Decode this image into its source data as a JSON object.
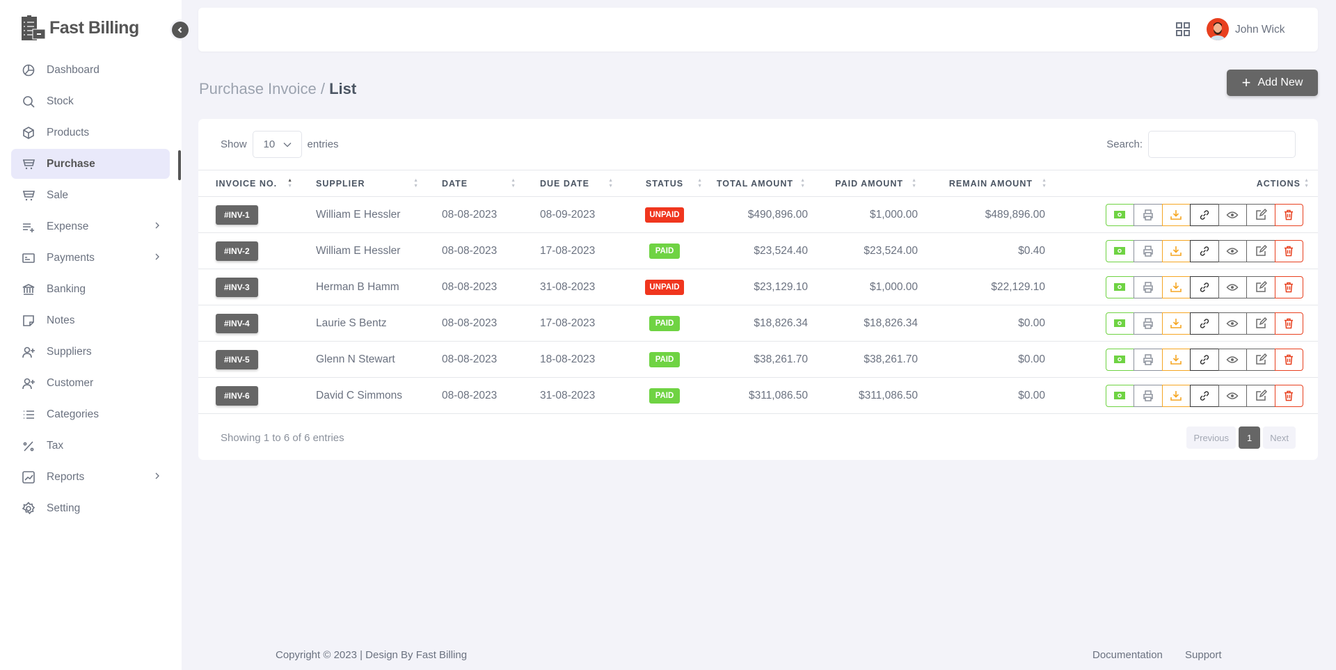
{
  "app": {
    "name": "Fast Billing"
  },
  "sidebar": {
    "items": [
      {
        "label": "Dashboard",
        "icon": "pie-chart-icon"
      },
      {
        "label": "Stock",
        "icon": "search-icon"
      },
      {
        "label": "Products",
        "icon": "box-icon"
      },
      {
        "label": "Purchase",
        "icon": "cart-icon",
        "active": true
      },
      {
        "label": "Sale",
        "icon": "cart-icon"
      },
      {
        "label": "Expense",
        "icon": "list-plus-icon",
        "submenu": true
      },
      {
        "label": "Payments",
        "icon": "card-icon",
        "submenu": true
      },
      {
        "label": "Banking",
        "icon": "bank-icon"
      },
      {
        "label": "Notes",
        "icon": "note-icon"
      },
      {
        "label": "Suppliers",
        "icon": "user-plus-icon"
      },
      {
        "label": "Customer",
        "icon": "user-plus-icon"
      },
      {
        "label": "Categories",
        "icon": "list-icon"
      },
      {
        "label": "Tax",
        "icon": "percent-icon"
      },
      {
        "label": "Reports",
        "icon": "chart-icon",
        "submenu": true
      },
      {
        "label": "Setting",
        "icon": "gear-icon"
      }
    ]
  },
  "header": {
    "user_name": "John Wick"
  },
  "page": {
    "breadcrumb_parent": "Purchase Invoice / ",
    "breadcrumb_current": "List",
    "add_new": "Add New"
  },
  "table_controls": {
    "show": "Show",
    "entries_value": "10",
    "entries": "entries",
    "search_label": "Search:"
  },
  "table": {
    "columns": [
      "INVOICE NO.",
      "SUPPLIER",
      "DATE",
      "DUE DATE",
      "STATUS",
      "TOTAL AMOUNT",
      "PAID AMOUNT",
      "REMAIN AMOUNT",
      "ACTIONS"
    ],
    "rows": [
      {
        "inv": "#INV-1",
        "supplier": "William E Hessler",
        "date": "08-08-2023",
        "due": "08-09-2023",
        "status": "UNPAID",
        "total": "$490,896.00",
        "paid": "$1,000.00",
        "remain": "$489,896.00"
      },
      {
        "inv": "#INV-2",
        "supplier": "William E Hessler",
        "date": "08-08-2023",
        "due": "17-08-2023",
        "status": "PAID",
        "total": "$23,524.40",
        "paid": "$23,524.00",
        "remain": "$0.40"
      },
      {
        "inv": "#INV-3",
        "supplier": "Herman B Hamm",
        "date": "08-08-2023",
        "due": "31-08-2023",
        "status": "UNPAID",
        "total": "$23,129.10",
        "paid": "$1,000.00",
        "remain": "$22,129.10"
      },
      {
        "inv": "#INV-4",
        "supplier": "Laurie S Bentz",
        "date": "08-08-2023",
        "due": "17-08-2023",
        "status": "PAID",
        "total": "$18,826.34",
        "paid": "$18,826.34",
        "remain": "$0.00"
      },
      {
        "inv": "#INV-5",
        "supplier": "Glenn N Stewart",
        "date": "08-08-2023",
        "due": "18-08-2023",
        "status": "PAID",
        "total": "$38,261.70",
        "paid": "$38,261.70",
        "remain": "$0.00"
      },
      {
        "inv": "#INV-6",
        "supplier": "David C Simmons",
        "date": "08-08-2023",
        "due": "31-08-2023",
        "status": "PAID",
        "total": "$311,086.50",
        "paid": "$311,086.50",
        "remain": "$0.00"
      }
    ]
  },
  "pagination": {
    "info": "Showing 1 to 6 of 6 entries",
    "previous": "Previous",
    "current": "1",
    "next": "Next"
  },
  "footer": {
    "copyright": "Copyright © 2023 | Design By Fast Billing",
    "documentation": "Documentation",
    "support": "Support"
  },
  "colors": {
    "payment": "#6fd343",
    "print": "#8b919c",
    "download": "#f5a623",
    "link": "#333333",
    "view": "#6b6b6b",
    "edit": "#6b6b6b",
    "delete": "#e8401f"
  }
}
